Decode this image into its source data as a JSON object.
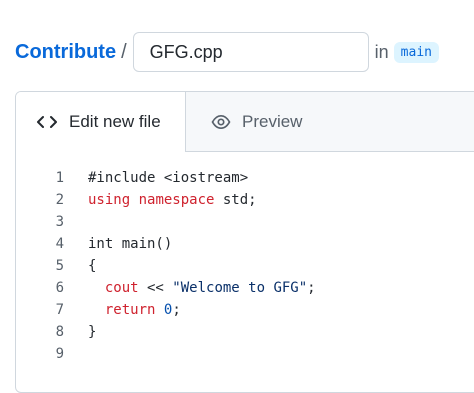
{
  "breadcrumb": {
    "repo": "Contribute",
    "separator": "/",
    "filename": "GFG.cpp",
    "in_label": "in",
    "branch": "main"
  },
  "tabs": {
    "edit": {
      "label": "Edit new file",
      "icon": "code-icon",
      "active": true
    },
    "preview": {
      "label": "Preview",
      "icon": "eye-icon",
      "active": false
    }
  },
  "code": {
    "line_numbers": [
      "1",
      "2",
      "3",
      "4",
      "5",
      "6",
      "7",
      "8",
      "9"
    ],
    "l1": "#include <iostream>",
    "l2_kw1": "using",
    "l2_kw2": "namespace",
    "l2_rest": " std;",
    "l4": "int main()",
    "l5": "{",
    "l6_indent": "  ",
    "l6_cout": "cout",
    "l6_op": " << ",
    "l6_str": "\"Welcome to GFG\"",
    "l6_end": ";",
    "l7_indent": "  ",
    "l7_kw": "return",
    "l7_sp": " ",
    "l7_num": "0",
    "l7_end": ";",
    "l8": "}"
  },
  "colors": {
    "link": "#0969da",
    "keyword": "#cf222e",
    "number": "#0550ae",
    "branch_bg": "#ddf4ff"
  }
}
